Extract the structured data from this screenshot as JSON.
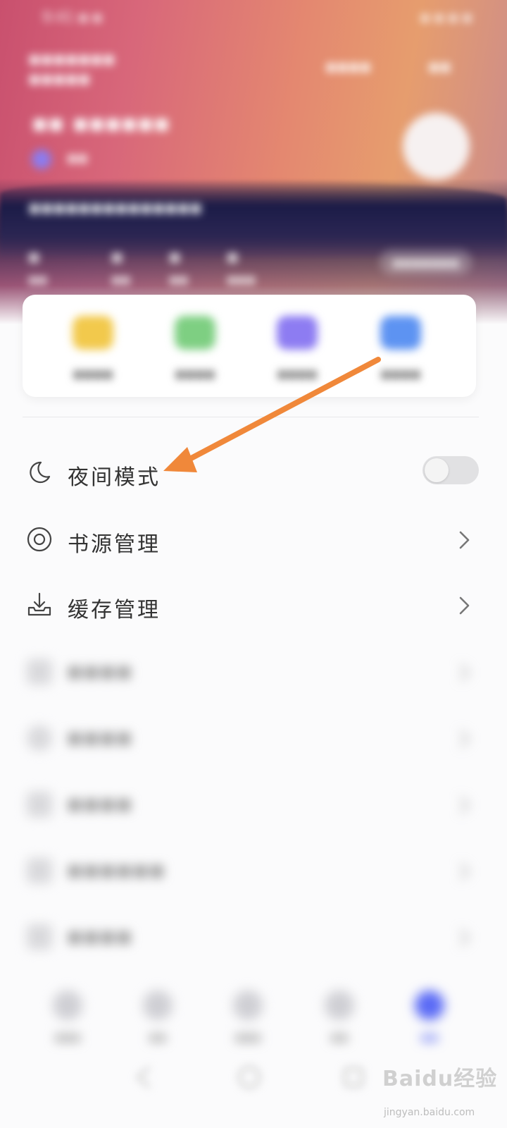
{
  "header": {
    "status_time": "9:41 ▪ ▪",
    "status_right": "▪ ▪ ▪ ▪",
    "app_title": "▪▪▪▪▪▪▪ ▪▪▪▪▪",
    "actions": [
      "▪▪▪▪",
      "▪▪"
    ],
    "user_name": "▪▪ ▪▪▪▪▪▪",
    "user_sub": "▪▪",
    "signature": "▪▪▪▪▪▪▪▪▪▪▪▪▪▪",
    "stats": [
      {
        "num": "▪",
        "label": "▪▪"
      },
      {
        "num": "▪",
        "label": "▪▪"
      },
      {
        "num": "▪",
        "label": "▪▪"
      },
      {
        "num": "▪",
        "label": "▪▪▪"
      }
    ],
    "stats_button": "▪▪▪▪▪▪▪"
  },
  "quick_actions": [
    {
      "label": "▪▪▪▪",
      "color": "#f2c94c"
    },
    {
      "label": "▪▪▪▪",
      "color": "#7ecf82"
    },
    {
      "label": "▪▪▪▪",
      "color": "#8d7cf2"
    },
    {
      "label": "▪▪▪▪",
      "color": "#5d93f2"
    }
  ],
  "menu": [
    {
      "label": "夜间模式",
      "icon": "moon-icon",
      "control": "toggle",
      "toggle_on": false
    },
    {
      "label": "书源管理",
      "icon": "target-icon",
      "control": "chevron"
    },
    {
      "label": "缓存管理",
      "icon": "download-tray-icon",
      "control": "chevron"
    },
    {
      "label": "▪▪▪▪",
      "icon": "generic-icon",
      "control": "chevron"
    },
    {
      "label": "▪▪▪▪",
      "icon": "generic-icon",
      "control": "chevron"
    },
    {
      "label": "▪▪▪▪",
      "icon": "generic-icon",
      "control": "chevron"
    },
    {
      "label": "▪▪▪▪▪▪",
      "icon": "generic-icon",
      "control": "chevron"
    },
    {
      "label": "▪▪▪▪",
      "icon": "generic-icon",
      "control": "chevron"
    }
  ],
  "tabbar": [
    {
      "label": "▪▪▪",
      "active": false
    },
    {
      "label": "▪▪",
      "active": false
    },
    {
      "label": "▪▪▪",
      "active": false
    },
    {
      "label": "▪▪",
      "active": false
    },
    {
      "label": "▪▪",
      "active": true
    }
  ],
  "annotation": {
    "arrow_color": "#f0883a"
  },
  "watermark": {
    "title": "Baidu经验",
    "url": "jingyan.baidu.com"
  }
}
